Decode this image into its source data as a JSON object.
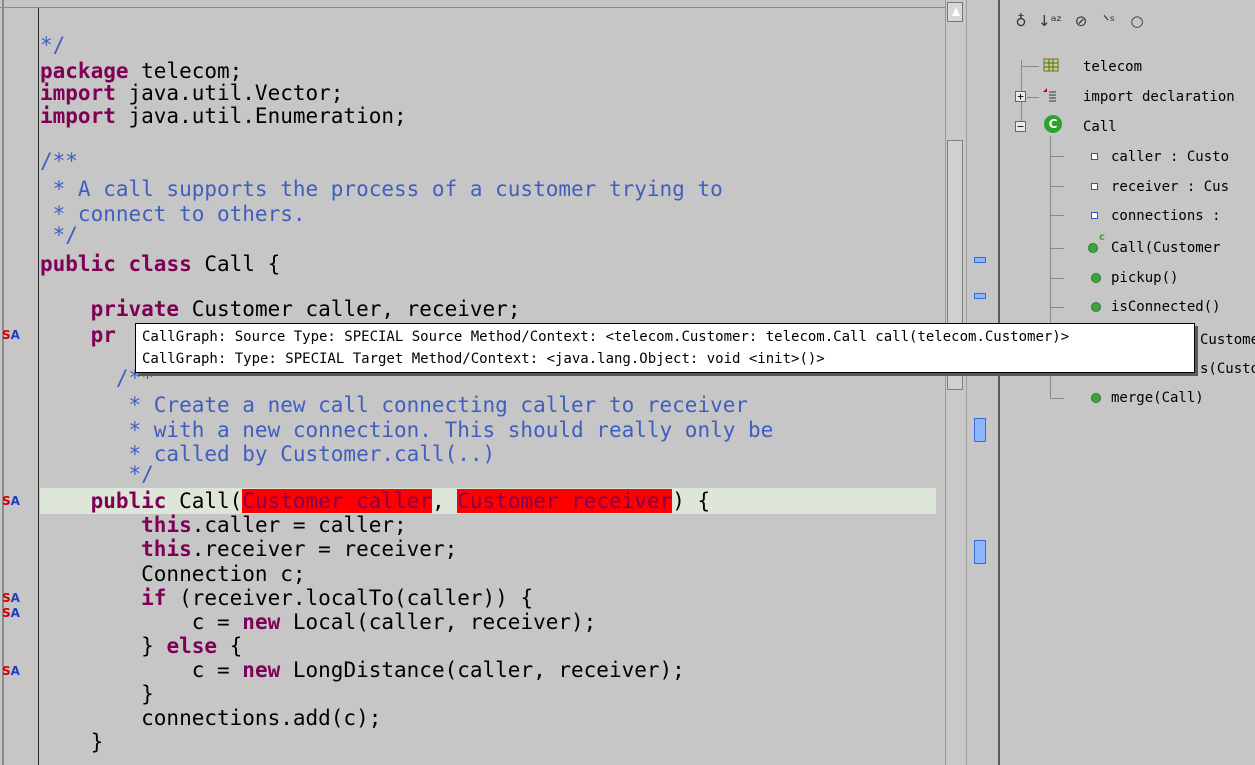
{
  "editor": {
    "lines": [
      {
        "text": "*/",
        "style": "cm"
      },
      {
        "text": "package telecom;"
      },
      {
        "text": "import java.util.Vector;"
      },
      {
        "text": "import java.util.Enumeration;"
      },
      {
        "text": "/**",
        "style": "cm"
      },
      {
        "text": " * A call supports the process of a customer trying to",
        "style": "cm"
      },
      {
        "text": " * connect to others.",
        "style": "cm"
      },
      {
        "text": " */",
        "style": "cm"
      },
      {
        "text": "public class Call {"
      },
      {
        "text": "    private Customer caller, receiver;"
      },
      {
        "text": "    pr"
      },
      {
        "text": "      /**",
        "style": "cm"
      },
      {
        "text": "       * Create a new call connecting caller to receiver",
        "style": "cm"
      },
      {
        "text": "       * with a new connection. This should really only be",
        "style": "cm"
      },
      {
        "text": "       * called by Customer.call(..)",
        "style": "cm"
      },
      {
        "text": "       */",
        "style": "cm"
      },
      {
        "text": "    public Call(Customer caller, Customer receiver) {"
      },
      {
        "text": "        this.caller = caller;"
      },
      {
        "text": "        this.receiver = receiver;"
      },
      {
        "text": "        Connection c;"
      },
      {
        "text": "        if (receiver.localTo(caller)) {"
      },
      {
        "text": "            c = new Local(caller, receiver);"
      },
      {
        "text": "        } else {"
      },
      {
        "text": "            c = new LongDistance(caller, receiver);"
      },
      {
        "text": "        }"
      },
      {
        "text": "        connections.add(c);"
      },
      {
        "text": "    }"
      }
    ],
    "tokens": {
      "package": "package",
      "import": "import",
      "public": "public",
      "class": "class",
      "private": "private",
      "this": "this",
      "if": "if",
      "else": "else",
      "new": "new",
      "customer_caller": "Customer caller",
      "customer_receiver": "Customer receiver"
    },
    "annotation_label_s": "S",
    "annotation_label_a": "A"
  },
  "tooltip": {
    "line1": "CallGraph: Source Type: SPECIAL Source Method/Context: <telecom.Customer: telecom.Call call(telecom.Customer)>",
    "line2": "CallGraph: Type: SPECIAL Target Method/Context: <java.lang.Object: void <init>()>"
  },
  "outline": {
    "toolbar_icons": [
      "hide-fields-icon",
      "sort-alpha-icon",
      "hide-static-icon",
      "hide-nonpublic-icon",
      "hide-local-types-icon"
    ],
    "items": [
      {
        "label": "telecom",
        "kind": "package"
      },
      {
        "label": "import declaration",
        "kind": "import"
      },
      {
        "label": "Call",
        "kind": "class"
      },
      {
        "label": "caller : Custo",
        "kind": "field"
      },
      {
        "label": "receiver : Cus",
        "kind": "field"
      },
      {
        "label": "connections :",
        "kind": "field"
      },
      {
        "label": "Call(Customer",
        "kind": "constructor"
      },
      {
        "label": "pickup()",
        "kind": "method"
      },
      {
        "label": "isConnected()",
        "kind": "method"
      },
      {
        "label": "Custome",
        "kind": "method-hidden"
      },
      {
        "label": "s(Custo",
        "kind": "method-hidden"
      },
      {
        "label": "merge(Call)",
        "kind": "method"
      }
    ]
  },
  "colors": {
    "keyword": "#7f0055",
    "comment": "#3f5fbf",
    "error_highlight": "#ff0000",
    "current_line": "#dde6d8",
    "background": "#c6c6c6"
  }
}
